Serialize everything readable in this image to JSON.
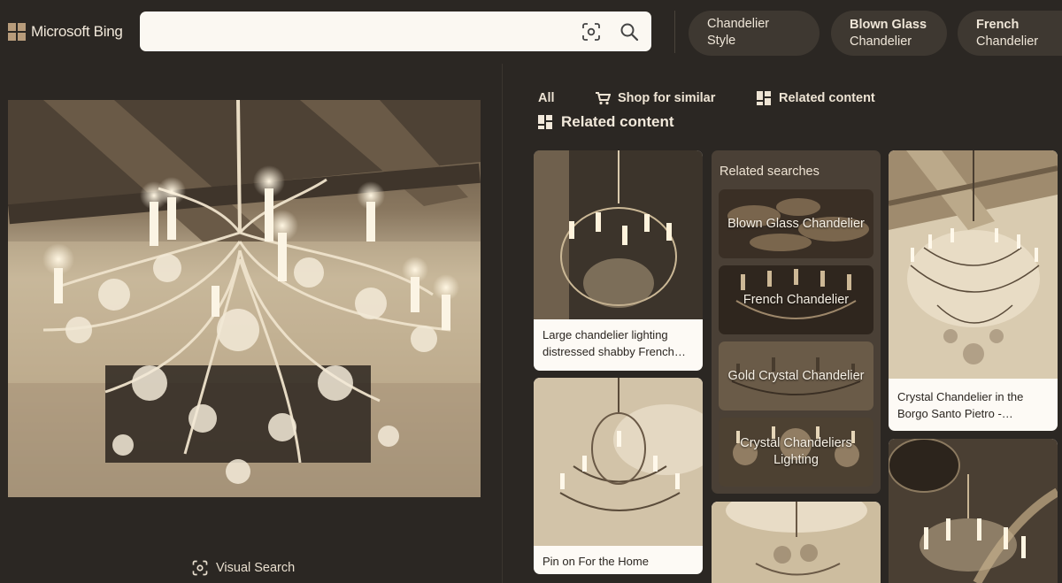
{
  "header": {
    "logo_text": "Microsoft Bing",
    "search_value": "",
    "pills": [
      {
        "line1": "Chandelier Style",
        "line2": ""
      },
      {
        "line1": "Blown Glass",
        "line2": "Chandelier"
      },
      {
        "line1": "French",
        "line2": "Chandelier"
      }
    ]
  },
  "left": {
    "visual_search_label": "Visual Search"
  },
  "tabs": {
    "all": "All",
    "shop": "Shop for similar",
    "related": "Related content"
  },
  "section_title": "Related content",
  "cards": [
    {
      "caption": "Large chandelier lighting distressed shabby French…"
    },
    {
      "caption": "Pin on For the Home"
    },
    {
      "caption": "Crystal Chandelier in the Borgo Santo Pietro -…"
    }
  ],
  "related_searches": {
    "title": "Related searches",
    "items": [
      "Blown Glass Chandelier",
      "French Chandelier",
      "Gold Crystal Chandelier",
      "Crystal Chandeliers Lighting"
    ]
  },
  "colors": {
    "background": "#2b2723",
    "pill": "#3e3831",
    "panel": "#4a4036",
    "card": "#fdfaf5",
    "sepia_tint": "#c9b596"
  }
}
